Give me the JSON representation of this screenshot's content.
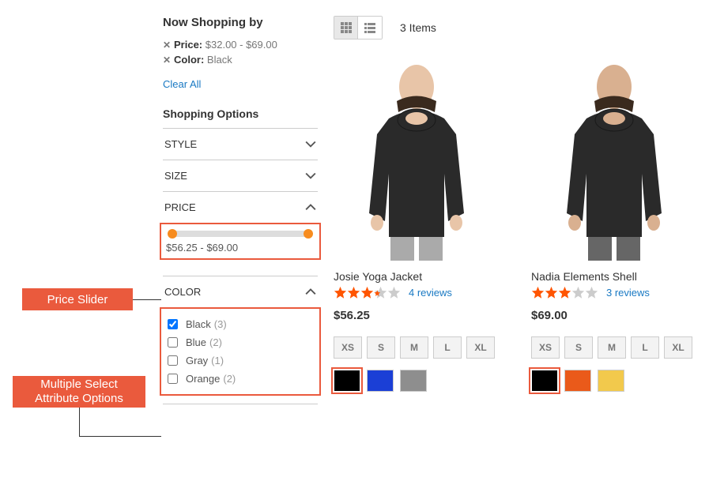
{
  "sidebar": {
    "now_shopping_by": "Now Shopping by",
    "applied": [
      {
        "label": "Price:",
        "value": "$32.00 - $69.00"
      },
      {
        "label": "Color:",
        "value": "Black"
      }
    ],
    "clear_all": "Clear All",
    "shopping_options": "Shopping Options",
    "filters": {
      "style": {
        "label": "STYLE"
      },
      "size": {
        "label": "SIZE"
      },
      "price": {
        "label": "PRICE",
        "range_text": "$56.25 - $69.00"
      },
      "color": {
        "label": "COLOR",
        "options": [
          {
            "name": "Black",
            "count": "(3)",
            "checked": true
          },
          {
            "name": "Blue",
            "count": "(2)",
            "checked": false
          },
          {
            "name": "Gray",
            "count": "(1)",
            "checked": false
          },
          {
            "name": "Orange",
            "count": "(2)",
            "checked": false
          }
        ]
      }
    }
  },
  "toolbar": {
    "count_text": "3 Items"
  },
  "products": [
    {
      "name": "Josie Yoga Jacket",
      "rating": 3.5,
      "reviews": "4 reviews",
      "price": "$56.25",
      "sizes": [
        "XS",
        "S",
        "M",
        "L",
        "XL"
      ],
      "swatches": [
        {
          "hex": "#000000",
          "selected": true
        },
        {
          "hex": "#1b3fd6",
          "selected": false
        },
        {
          "hex": "#8e8e8e",
          "selected": false
        }
      ]
    },
    {
      "name": "Nadia Elements Shell",
      "rating": 3.0,
      "reviews": "3 reviews",
      "price": "$69.00",
      "sizes": [
        "XS",
        "S",
        "M",
        "L",
        "XL"
      ],
      "swatches": [
        {
          "hex": "#000000",
          "selected": true
        },
        {
          "hex": "#ea5a1a",
          "selected": false
        },
        {
          "hex": "#f2c94c",
          "selected": false
        }
      ]
    }
  ],
  "callouts": {
    "price_slider": "Price Slider",
    "multi_select": "Multiple Select Attribute Options"
  }
}
